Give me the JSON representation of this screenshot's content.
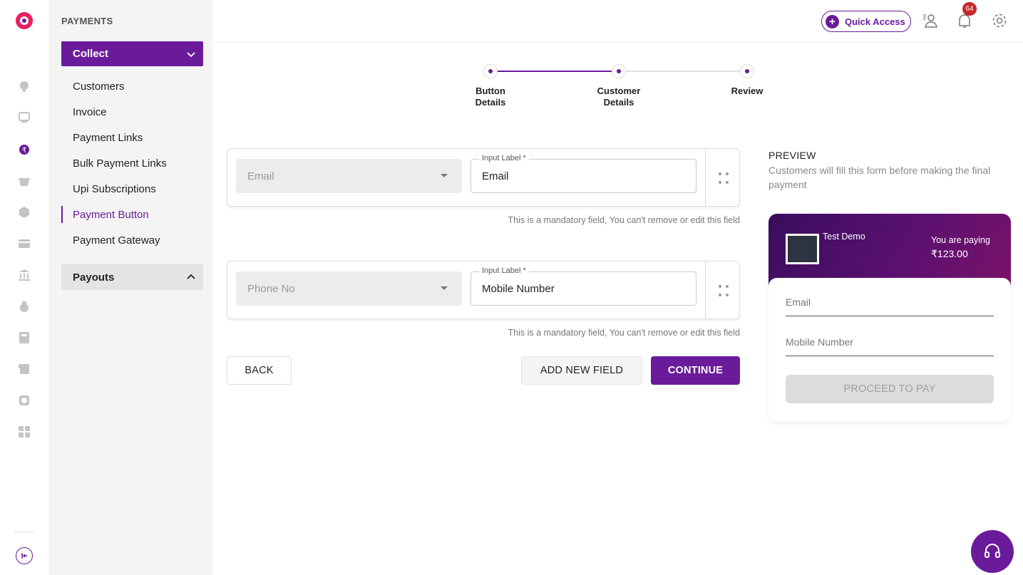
{
  "sidebar": {
    "section_title": "PAYMENTS",
    "collect_group": "Collect",
    "items": [
      {
        "label": "Customers"
      },
      {
        "label": "Invoice"
      },
      {
        "label": "Payment Links"
      },
      {
        "label": "Bulk Payment Links"
      },
      {
        "label": "Upi Subscriptions"
      },
      {
        "label": "Payment Button",
        "active": true
      },
      {
        "label": "Payment Gateway"
      }
    ],
    "payouts_group": "Payouts"
  },
  "topbar": {
    "quick_access_label": "Quick Access",
    "notification_count": "64",
    "icons": [
      "user-list-icon",
      "notification-icon",
      "settings-icon"
    ]
  },
  "stepper": {
    "steps": [
      {
        "line1": "Button",
        "line2": "Details"
      },
      {
        "line1": "Customer",
        "line2": "Details"
      },
      {
        "line1": "Review",
        "line2": ""
      }
    ]
  },
  "fields": [
    {
      "type_value": "Email",
      "input_label": "Input Label *",
      "label_value": "Email",
      "note": "This is a mandatory field, You can't remove or edit this field"
    },
    {
      "type_value": "Phone No",
      "input_label": "Input Label *",
      "label_value": "Mobile Number",
      "note": "This is a mandatory field, You can't remove or edit this field"
    }
  ],
  "actions": {
    "back": "BACK",
    "add_new_field": "ADD NEW FIELD",
    "continue": "CONTINUE"
  },
  "preview": {
    "title": "PREVIEW",
    "description": "Customers will fill this form before making the final payment",
    "merchant": "Test Demo",
    "paying_label": "You are paying",
    "amount": "₹123.00",
    "fields": [
      "Email",
      "Mobile Number"
    ],
    "proceed": "PROCEED TO PAY"
  },
  "colors": {
    "brand": "#6a1b9a",
    "badge": "#c62828"
  }
}
